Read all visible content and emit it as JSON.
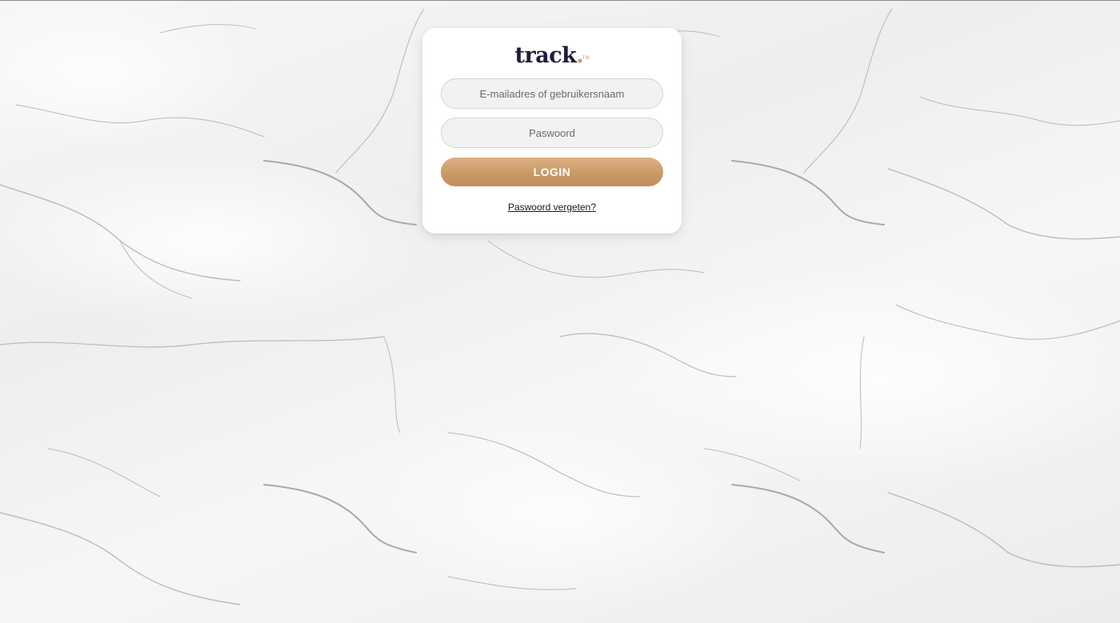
{
  "background": {
    "texture": "white-marble"
  },
  "logo": {
    "word": "track",
    "dot": ".",
    "superscript": "TM",
    "colors": {
      "word": "#1d1d3b",
      "accent": "#c99a66"
    }
  },
  "form": {
    "email_placeholder": "E-mailadres of gebruikersnaam",
    "email_value": "",
    "password_placeholder": "Paswoord",
    "password_value": "",
    "login_label": "LOGIN",
    "forgot_label": "Paswoord vergeten?"
  },
  "colors": {
    "button_gradient_top": "#dcb083",
    "button_gradient_bottom": "#be8f5c",
    "card": "#ffffff",
    "field": "#f2f2f2"
  }
}
